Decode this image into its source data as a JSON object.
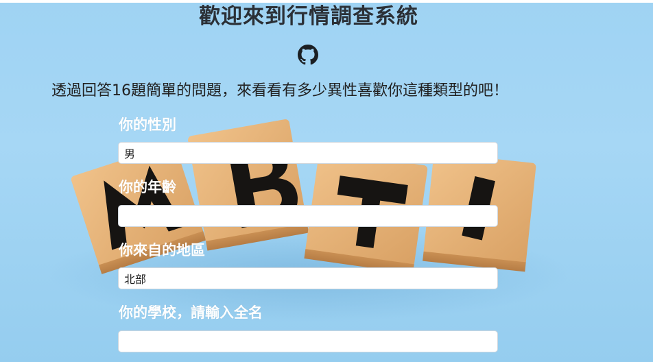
{
  "header": {
    "title": "歡迎來到行情調查系統",
    "github_icon": "github-icon",
    "subtitle": "透過回答16題簡單的問題，來看看有多少異性喜歡你這種類型的吧！"
  },
  "background": {
    "blocks": [
      "M",
      "B",
      "T",
      "I"
    ],
    "colors": {
      "sky": "#a6d7f5",
      "wood": "#e8b77c",
      "ink": "#161412"
    }
  },
  "form": {
    "gender": {
      "label": "你的性別",
      "value": "男"
    },
    "age": {
      "label": "你的年齡",
      "value": ""
    },
    "region": {
      "label": "你來自的地區",
      "value": "北部"
    },
    "school": {
      "label": "你的學校，請輸入全名",
      "value": ""
    }
  }
}
